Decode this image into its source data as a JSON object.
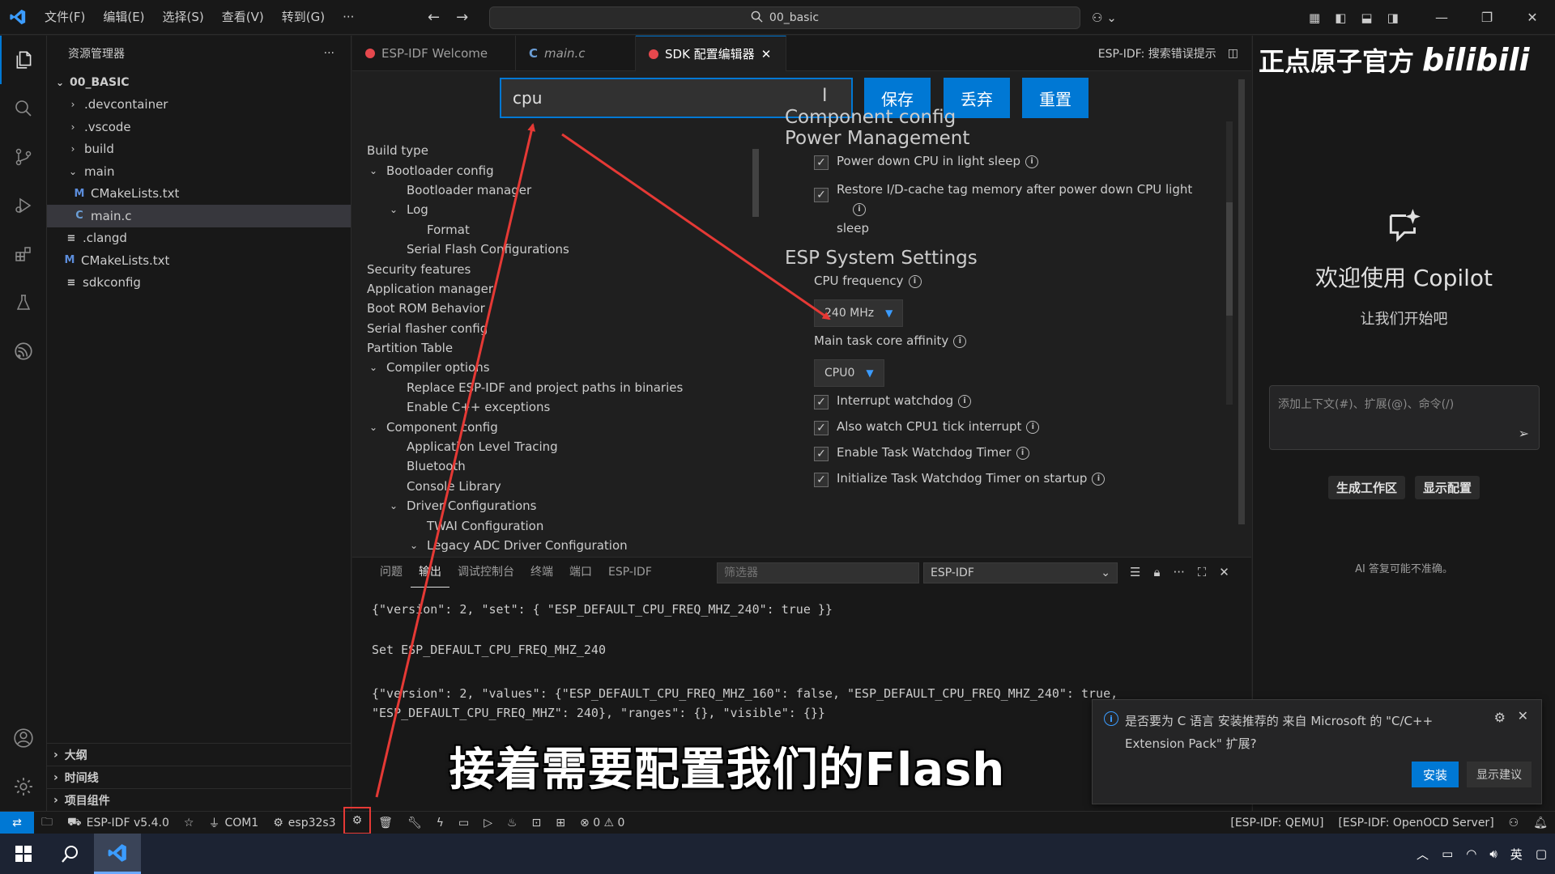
{
  "titlebar": {
    "menus": [
      "文件(F)",
      "编辑(E)",
      "选择(S)",
      "查看(V)",
      "转到(G)",
      "···"
    ],
    "command_center": "00_basic"
  },
  "explorer": {
    "title": "资源管理器",
    "more": "···",
    "root": "00_BASIC",
    "items": [
      {
        "label": ".devcontainer",
        "kind": "folder",
        "depth": 1
      },
      {
        "label": ".vscode",
        "kind": "folder",
        "depth": 1
      },
      {
        "label": "build",
        "kind": "folder",
        "depth": 1
      },
      {
        "label": "main",
        "kind": "folder-open",
        "depth": 1
      },
      {
        "label": "CMakeLists.txt",
        "kind": "m",
        "depth": 2
      },
      {
        "label": "main.c",
        "kind": "c",
        "depth": 2
      },
      {
        "label": ".clangd",
        "kind": "lines",
        "depth": 1
      },
      {
        "label": "CMakeLists.txt",
        "kind": "m",
        "depth": 1
      },
      {
        "label": "sdkconfig",
        "kind": "lines",
        "depth": 1
      }
    ],
    "sections": [
      "大纲",
      "时间线",
      "项目组件"
    ]
  },
  "tabs": [
    {
      "label": "ESP-IDF Welcome",
      "icon": "esp-dot"
    },
    {
      "label": "main.c",
      "icon": "c"
    },
    {
      "label": "SDK 配置编辑器",
      "icon": "esp-dot"
    }
  ],
  "tabs_right": {
    "label": "ESP-IDF:  搜索错误提示"
  },
  "sdk": {
    "search_value": "cpu",
    "buttons": {
      "save": "保存",
      "discard": "丢弃",
      "reset": "重置"
    },
    "tree": [
      {
        "label": "Build type",
        "depth": 0,
        "chev": ""
      },
      {
        "label": "Bootloader config",
        "depth": 0,
        "chev": "v"
      },
      {
        "label": "Bootloader manager",
        "depth": 1,
        "chev": ""
      },
      {
        "label": "Log",
        "depth": 1,
        "chev": "v"
      },
      {
        "label": "Format",
        "depth": 2,
        "chev": ""
      },
      {
        "label": "Serial Flash Configurations",
        "depth": 1,
        "chev": ""
      },
      {
        "label": "Security features",
        "depth": 0,
        "chev": ""
      },
      {
        "label": "Application manager",
        "depth": 0,
        "chev": ""
      },
      {
        "label": "Boot ROM Behavior",
        "depth": 0,
        "chev": ""
      },
      {
        "label": "Serial flasher config",
        "depth": 0,
        "chev": ""
      },
      {
        "label": "Partition Table",
        "depth": 0,
        "chev": ""
      },
      {
        "label": "Compiler options",
        "depth": 0,
        "chev": "v"
      },
      {
        "label": "Replace ESP-IDF and project paths in binaries",
        "depth": 1,
        "chev": ""
      },
      {
        "label": "Enable C++ exceptions",
        "depth": 1,
        "chev": ""
      },
      {
        "label": "Component config",
        "depth": 0,
        "chev": "v"
      },
      {
        "label": "Application Level Tracing",
        "depth": 1,
        "chev": ""
      },
      {
        "label": "Bluetooth",
        "depth": 1,
        "chev": ""
      },
      {
        "label": "Console Library",
        "depth": 1,
        "chev": ""
      },
      {
        "label": "Driver Configurations",
        "depth": 1,
        "chev": "v"
      },
      {
        "label": "TWAI Configuration",
        "depth": 2,
        "chev": ""
      },
      {
        "label": "Legacy ADC Driver Configuration",
        "depth": 2,
        "chev": "v"
      }
    ],
    "settings": {
      "partial_title": "Component config",
      "power_title": "Power Management",
      "power_down_cpu": "Power down CPU in light sleep",
      "restore_cache_1": "Restore I/D-cache tag memory after power down CPU light",
      "restore_cache_2": "sleep",
      "esp_system_title": "ESP System Settings",
      "cpu_freq_label": "CPU frequency",
      "cpu_freq_value": "240 MHz",
      "main_task_label": "Main task core affinity",
      "main_task_value": "CPU0",
      "interrupt_wdt": "Interrupt watchdog",
      "watch_cpu1": "Also watch CPU1 tick interrupt",
      "task_wdt": "Enable Task Watchdog Timer",
      "init_task_wdt": "Initialize Task Watchdog Timer on startup"
    }
  },
  "panel": {
    "tabs": [
      "问题",
      "输出",
      "调试控制台",
      "终端",
      "端口",
      "ESP-IDF"
    ],
    "active_tab": 1,
    "filter_placeholder": "筛选器",
    "channel": "ESP-IDF",
    "output": [
      "{\"version\": 2, \"set\": { \"ESP_DEFAULT_CPU_FREQ_MHZ_240\": true }}",
      "",
      "Set ESP_DEFAULT_CPU_FREQ_MHZ_240",
      "",
      "{\"version\": 2, \"values\": {\"ESP_DEFAULT_CPU_FREQ_MHZ_160\": false, \"ESP_DEFAULT_CPU_FREQ_MHZ_240\": true,",
      "\"ESP_DEFAULT_CPU_FREQ_MHZ\": 240}, \"ranges\": {}, \"visible\": {}}"
    ]
  },
  "copilot": {
    "brand_text": "正点原子官方",
    "brand_logo": "bilibili",
    "welcome": "欢迎使用 Copilot",
    "sub": "让我们开始吧",
    "placeholder": "添加上下文(#)、扩展(@)、命令(/)",
    "btn_workspace": "生成工作区",
    "btn_config": "显示配置",
    "disclaimer": "AI 答复可能不准确。"
  },
  "notification": {
    "message": "是否要为 C 语言 安装推荐的 来自 Microsoft 的 \"C/C++ Extension Pack\" 扩展?",
    "install": "安装",
    "later": "显示建议"
  },
  "statusbar": {
    "idf_version": "ESP-IDF v5.4.0",
    "port": "COM1",
    "target": "esp32s3",
    "problems": "⊗ 0 ⚠ 0",
    "qemu": "[ESP-IDF: QEMU]",
    "openocd": "[ESP-IDF: OpenOCD Server]"
  },
  "subtitle": "接着需要配置我们的Flash",
  "colors": {
    "accent": "#0078d4",
    "annotation": "#e53935"
  }
}
